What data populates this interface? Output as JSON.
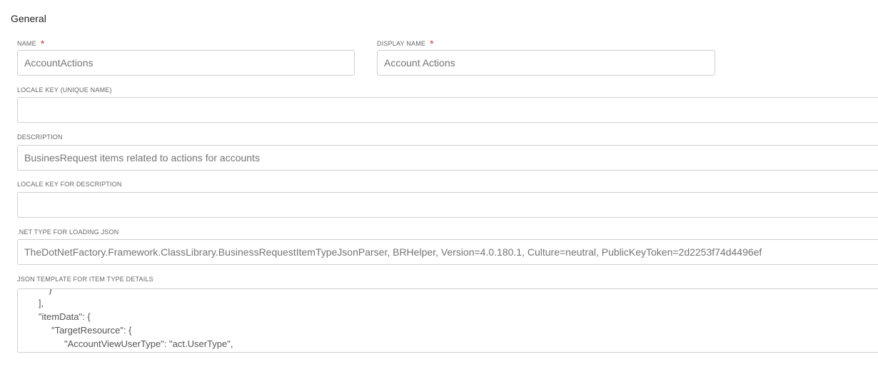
{
  "section": {
    "title": "General"
  },
  "fields": {
    "name": {
      "label": "NAME",
      "required_mark": "*",
      "value": "AccountActions"
    },
    "display_name": {
      "label": "DISPLAY NAME",
      "required_mark": "*",
      "value": "Account Actions"
    },
    "locale_key": {
      "label": "LOCALE KEY (UNIQUE NAME)",
      "value": ""
    },
    "description": {
      "label": "DESCRIPTION",
      "value": "BusinesRequest items related to actions for accounts"
    },
    "locale_key_description": {
      "label": "LOCALE KEY FOR DESCRIPTION",
      "value": ""
    },
    "net_type": {
      "label": ".NET TYPE FOR LOADING JSON",
      "value": "TheDotNetFactory.Framework.ClassLibrary.BusinessRequestItemTypeJsonParser, BRHelper, Version=4.0.180.1, Culture=neutral, PublicKeyToken=2d2253f74d4496ef"
    },
    "json_template": {
      "label": "JSON TEMPLATE FOR ITEM TYPE DETAILS",
      "lines": [
        "            }",
        "        ],",
        "        \"itemData\": {",
        "             \"TargetResource\": {",
        "                  \"AccountViewUserType\": \"act.UserType\","
      ]
    }
  }
}
